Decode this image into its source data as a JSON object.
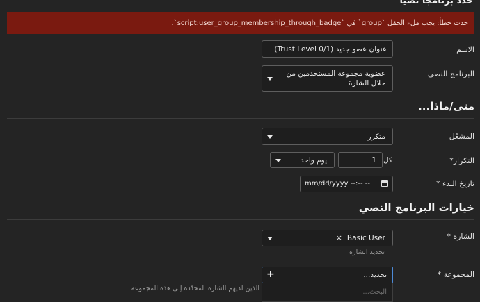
{
  "page": {
    "top_title": "حدّد برنامجًا نصيًا",
    "error_message": "حدث خطأ: يجب ملء الحقل `group` في `script:user_group_membership_through_badge`."
  },
  "form": {
    "name": {
      "label": "الاسم",
      "value": "عنوان عضو جديد (Trust Level 0/1)"
    },
    "script": {
      "label": "البرنامج النصي",
      "value": "عضوية مجموعة المستخدمين من خلال الشارة"
    }
  },
  "trigger_section": {
    "title": "متى/ماذا...",
    "trigger": {
      "label": "المشغّل",
      "value": "متكرر"
    },
    "recurrence": {
      "label": "التكرار",
      "required_mark": "*",
      "every_label": "كل",
      "count": "1",
      "unit": "يوم واحد"
    },
    "start_date": {
      "label": "تاريخ البدء",
      "required_mark": "*",
      "placeholder": "mm/dd/yyyy --:-- --"
    }
  },
  "options_section": {
    "title": "خيارات البرنامج النصي",
    "badge": {
      "label": "الشارة",
      "required_mark": "*",
      "value": "Basic User",
      "clear_symbol": "×",
      "hint": "تحديد الشارة"
    },
    "group": {
      "label": "المجموعة",
      "required_mark": "*",
      "placeholder": "تحديد...",
      "add_symbol": "+",
      "search_placeholder": "البحث...",
      "hint": "الذين لديهم الشارة المحدّدة إلى هذه المجموعة"
    }
  },
  "colors": {
    "background": "#242424",
    "error_bg": "#7a1a10",
    "focus_border": "#4d8ad6"
  }
}
